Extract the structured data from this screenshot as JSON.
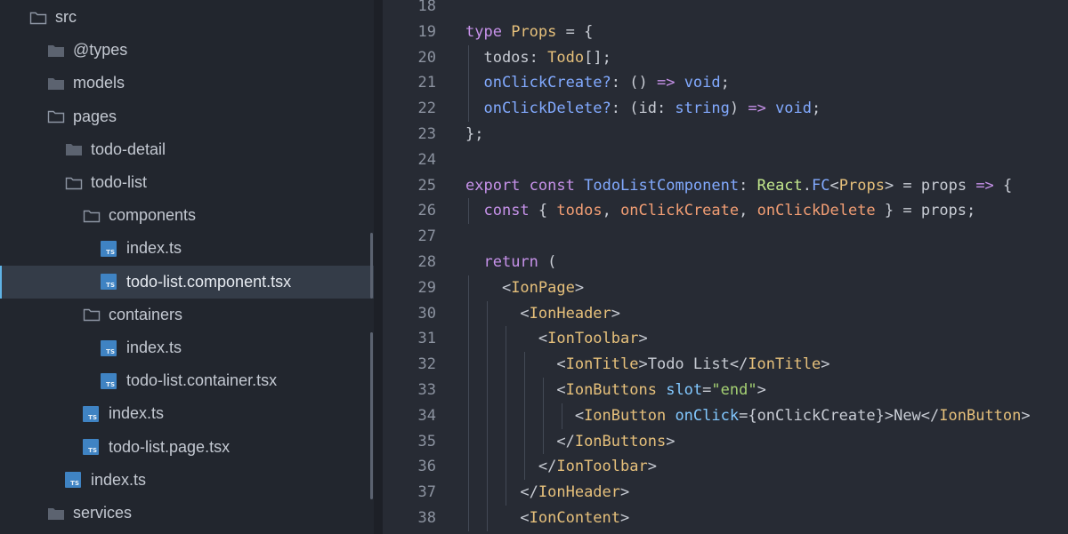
{
  "explorer": {
    "items": [
      {
        "label": "src",
        "kind": "folder-open",
        "depth": 0,
        "selected": false
      },
      {
        "label": "@types",
        "kind": "folder",
        "depth": 1,
        "selected": false
      },
      {
        "label": "models",
        "kind": "folder",
        "depth": 1,
        "selected": false
      },
      {
        "label": "pages",
        "kind": "folder-open",
        "depth": 1,
        "selected": false
      },
      {
        "label": "todo-detail",
        "kind": "folder",
        "depth": 2,
        "selected": false
      },
      {
        "label": "todo-list",
        "kind": "folder-open",
        "depth": 2,
        "selected": false
      },
      {
        "label": "components",
        "kind": "folder-open",
        "depth": 3,
        "selected": false
      },
      {
        "label": "index.ts",
        "kind": "ts-file",
        "depth": 4,
        "selected": false
      },
      {
        "label": "todo-list.component.tsx",
        "kind": "ts-file",
        "depth": 4,
        "selected": true
      },
      {
        "label": "containers",
        "kind": "folder-open",
        "depth": 3,
        "selected": false
      },
      {
        "label": "index.ts",
        "kind": "ts-file",
        "depth": 4,
        "selected": false
      },
      {
        "label": "todo-list.container.tsx",
        "kind": "ts-file",
        "depth": 4,
        "selected": false
      },
      {
        "label": "index.ts",
        "kind": "ts-file",
        "depth": 3,
        "selected": false
      },
      {
        "label": "todo-list.page.tsx",
        "kind": "ts-file",
        "depth": 3,
        "selected": false
      },
      {
        "label": "index.ts",
        "kind": "ts-file",
        "depth": 2,
        "selected": false
      },
      {
        "label": "services",
        "kind": "folder",
        "depth": 1,
        "selected": false
      }
    ],
    "ts_badge": "TS"
  },
  "editor": {
    "lines": [
      {
        "n": "18",
        "tokens": []
      },
      {
        "n": "19",
        "tokens": [
          [
            "type",
            "keyword"
          ],
          [
            " ",
            "text"
          ],
          [
            "Props",
            "type"
          ],
          [
            " = {",
            "punct"
          ]
        ]
      },
      {
        "n": "20",
        "tokens": [
          [
            "  todos",
            "prop"
          ],
          [
            ": ",
            "punct"
          ],
          [
            "Todo",
            "type"
          ],
          [
            "[];",
            "punct"
          ]
        ]
      },
      {
        "n": "21",
        "tokens": [
          [
            "  onClickCreate?",
            "fn"
          ],
          [
            ": () ",
            "punct"
          ],
          [
            "=>",
            "op"
          ],
          [
            " ",
            "text"
          ],
          [
            "void",
            "prim"
          ],
          [
            ";",
            "punct"
          ]
        ]
      },
      {
        "n": "22",
        "tokens": [
          [
            "  onClickDelete?",
            "fn"
          ],
          [
            ": (id: ",
            "punct"
          ],
          [
            "string",
            "prim"
          ],
          [
            ") ",
            "punct"
          ],
          [
            "=>",
            "op"
          ],
          [
            " ",
            "text"
          ],
          [
            "void",
            "prim"
          ],
          [
            ";",
            "punct"
          ]
        ]
      },
      {
        "n": "23",
        "tokens": [
          [
            "};",
            "punct"
          ]
        ]
      },
      {
        "n": "24",
        "tokens": []
      },
      {
        "n": "25",
        "tokens": [
          [
            "export",
            "keyword"
          ],
          [
            " ",
            "text"
          ],
          [
            "const",
            "keyword"
          ],
          [
            " ",
            "text"
          ],
          [
            "TodoListComponent",
            "fn"
          ],
          [
            ": ",
            "punct"
          ],
          [
            "React",
            "react"
          ],
          [
            ".",
            "punct"
          ],
          [
            "FC",
            "fn"
          ],
          [
            "<",
            "punct"
          ],
          [
            "Props",
            "type"
          ],
          [
            "> = props ",
            "punct"
          ],
          [
            "=>",
            "op"
          ],
          [
            " {",
            "punct"
          ]
        ]
      },
      {
        "n": "26",
        "tokens": [
          [
            "  ",
            "text"
          ],
          [
            "const",
            "keyword"
          ],
          [
            " { ",
            "punct"
          ],
          [
            "todos",
            "var"
          ],
          [
            ", ",
            "punct"
          ],
          [
            "onClickCreate",
            "var"
          ],
          [
            ", ",
            "punct"
          ],
          [
            "onClickDelete",
            "var"
          ],
          [
            " } = props;",
            "punct"
          ]
        ]
      },
      {
        "n": "27",
        "tokens": []
      },
      {
        "n": "28",
        "tokens": [
          [
            "  ",
            "text"
          ],
          [
            "return",
            "keyword"
          ],
          [
            " (",
            "punct"
          ]
        ]
      },
      {
        "n": "29",
        "tokens": [
          [
            "    <",
            "punct"
          ],
          [
            "IonPage",
            "tag"
          ],
          [
            ">",
            "punct"
          ]
        ]
      },
      {
        "n": "30",
        "tokens": [
          [
            "      <",
            "punct"
          ],
          [
            "IonHeader",
            "tag"
          ],
          [
            ">",
            "punct"
          ]
        ]
      },
      {
        "n": "31",
        "tokens": [
          [
            "        <",
            "punct"
          ],
          [
            "IonToolbar",
            "tag"
          ],
          [
            ">",
            "punct"
          ]
        ]
      },
      {
        "n": "32",
        "tokens": [
          [
            "          <",
            "punct"
          ],
          [
            "IonTitle",
            "tag"
          ],
          [
            ">Todo List</",
            "text"
          ],
          [
            "IonTitle",
            "tag"
          ],
          [
            ">",
            "punct"
          ]
        ]
      },
      {
        "n": "33",
        "tokens": [
          [
            "          <",
            "punct"
          ],
          [
            "IonButtons",
            "tag"
          ],
          [
            " ",
            "text"
          ],
          [
            "slot",
            "attr"
          ],
          [
            "=",
            "punct"
          ],
          [
            "\"end\"",
            "string"
          ],
          [
            ">",
            "punct"
          ]
        ]
      },
      {
        "n": "34",
        "tokens": [
          [
            "            <",
            "punct"
          ],
          [
            "IonButton",
            "tag"
          ],
          [
            " ",
            "text"
          ],
          [
            "onClick",
            "attr"
          ],
          [
            "={onClickCreate}>New</",
            "punct"
          ],
          [
            "IonButton",
            "tag"
          ],
          [
            ">",
            "punct"
          ]
        ]
      },
      {
        "n": "35",
        "tokens": [
          [
            "          </",
            "punct"
          ],
          [
            "IonButtons",
            "tag"
          ],
          [
            ">",
            "punct"
          ]
        ]
      },
      {
        "n": "36",
        "tokens": [
          [
            "        </",
            "punct"
          ],
          [
            "IonToolbar",
            "tag"
          ],
          [
            ">",
            "punct"
          ]
        ]
      },
      {
        "n": "37",
        "tokens": [
          [
            "      </",
            "punct"
          ],
          [
            "IonHeader",
            "tag"
          ],
          [
            ">",
            "punct"
          ]
        ]
      },
      {
        "n": "38",
        "tokens": [
          [
            "      <",
            "punct"
          ],
          [
            "IonContent",
            "tag"
          ],
          [
            ">",
            "punct"
          ]
        ]
      }
    ]
  }
}
